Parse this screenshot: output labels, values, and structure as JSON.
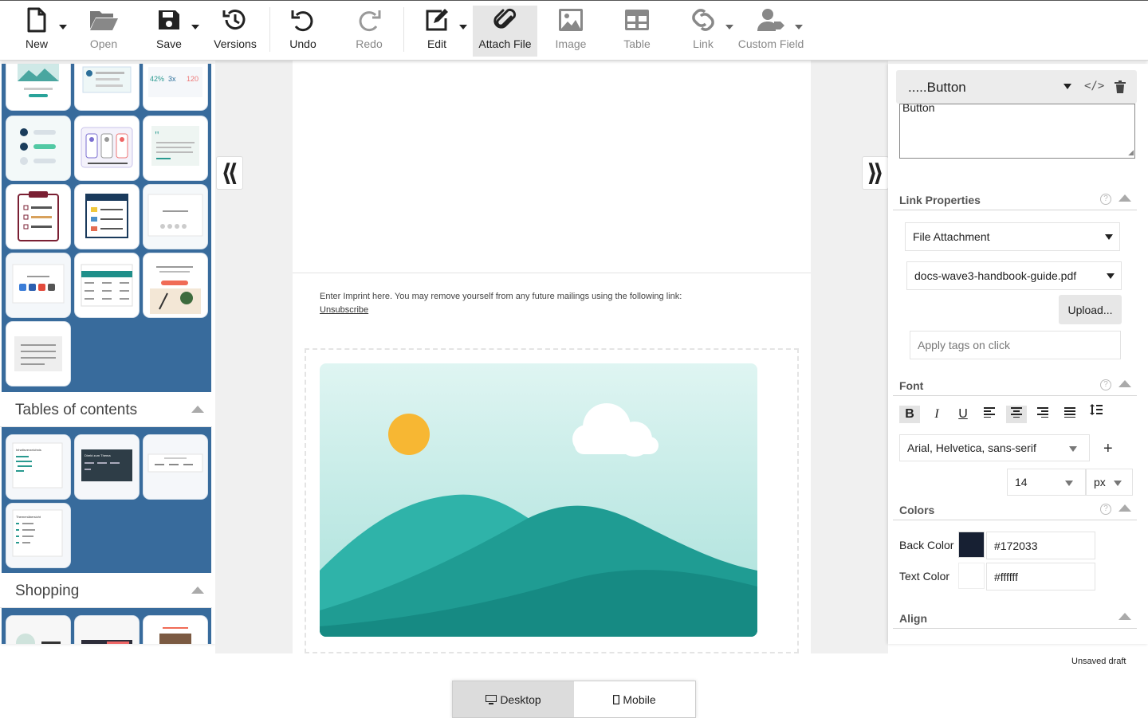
{
  "toolbar": {
    "new": "New",
    "open": "Open",
    "save": "Save",
    "versions": "Versions",
    "undo": "Undo",
    "redo": "Redo",
    "edit": "Edit",
    "attach_file": "Attach File",
    "image": "Image",
    "table": "Table",
    "link": "Link",
    "custom_field": "Custom Field"
  },
  "left_panel": {
    "sections": [
      {
        "title": "Tables of contents"
      },
      {
        "title": "Shopping"
      }
    ],
    "tile_texts": {
      "stat_a": "42%",
      "stat_b": "3x",
      "stat_c": "120",
      "toc1_title": "Inhaltsverzeichnis",
      "toc2_title": "Direkt zum Thema",
      "toc4_title": "Themenübersicht"
    }
  },
  "canvas": {
    "footer_text": "Enter Imprint here. You may remove yourself from any future mailings using the following link:",
    "unsubscribe": "Unsubscribe"
  },
  "right_panel": {
    "element_name": ".....Button",
    "textarea_value": "Button",
    "link_properties": {
      "title": "Link Properties",
      "type": "File Attachment",
      "file": "docs-wave3-handbook-guide.pdf",
      "upload": "Upload...",
      "tags_placeholder": "Apply tags on click"
    },
    "font": {
      "title": "Font",
      "family": "Arial, Helvetica, sans-serif",
      "size": "14",
      "unit": "px"
    },
    "colors": {
      "title": "Colors",
      "back_label": "Back Color",
      "back_value": "#172033",
      "text_label": "Text Color",
      "text_value": "#ffffff"
    },
    "align": {
      "title": "Align"
    }
  },
  "status": {
    "draft": "Unsaved draft",
    "desktop": "Desktop",
    "mobile": "Mobile"
  },
  "colors": {
    "tiles_bg": "#386b9c",
    "back_swatch": "#172033",
    "teal": "#1f9c93"
  }
}
